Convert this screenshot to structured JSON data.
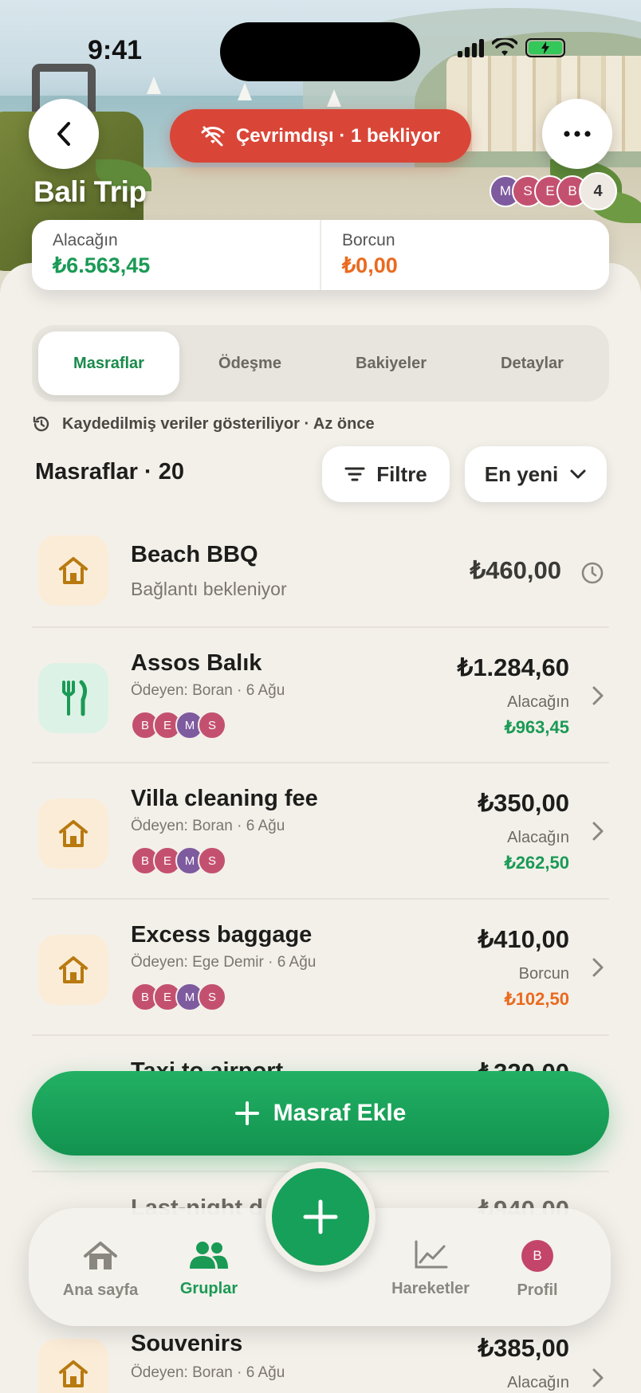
{
  "status_bar": {
    "time": "9:41"
  },
  "offline_banner": {
    "label": "Çevrimdışı · 1 bekliyor"
  },
  "group": {
    "title": "Bali Trip",
    "members": [
      "M",
      "S",
      "E",
      "B"
    ],
    "member_count": "4"
  },
  "balances": {
    "owed_label": "Alacağın",
    "owed_value": "₺6.563,45",
    "owe_label": "Borcun",
    "owe_value": "₺0,00"
  },
  "tabs": [
    {
      "label": "Masraflar",
      "active": true
    },
    {
      "label": "Ödeşme",
      "active": false
    },
    {
      "label": "Bakiyeler",
      "active": false
    },
    {
      "label": "Detaylar",
      "active": false
    }
  ],
  "cached_notice": "Kaydedilmiş veriler gösteriliyor · Az önce",
  "list": {
    "heading": "Masraflar · 20",
    "filter_label": "Filtre",
    "sort_label": "En yeni",
    "expenses": [
      {
        "title": "Beach BBQ",
        "subtitle": "Bağlantı bekleniyor",
        "amount": "₺460,00",
        "icon": "home-icon",
        "pending": true
      },
      {
        "title": "Assos Balık",
        "subtitle": "Ödeyen: Boran · 6 Ağu",
        "amount": "₺1.284,60",
        "share_label": "Alacağın",
        "share_value": "₺963,45",
        "icon": "fork-knife-icon",
        "participants": [
          "B",
          "E",
          "M",
          "S"
        ]
      },
      {
        "title": "Villa cleaning fee",
        "subtitle": "Ödeyen: Boran · 6 Ağu",
        "amount": "₺350,00",
        "share_label": "Alacağın",
        "share_value": "₺262,50",
        "icon": "home-icon",
        "participants": [
          "B",
          "E",
          "M",
          "S"
        ]
      },
      {
        "title": "Excess baggage",
        "subtitle": "Ödeyen: Ege Demir · 6 Ağu",
        "amount": "₺410,00",
        "share_label": "Borcun",
        "share_value": "₺102,50",
        "icon": "home-icon",
        "participants": [
          "B",
          "E",
          "M",
          "S"
        ]
      },
      {
        "title": "Taxi to airport",
        "amount": "₺320,00"
      },
      {
        "title": "Last-night d",
        "amount": "₺940,00"
      },
      {
        "title": "Souvenirs",
        "subtitle": "Ödeyen: Boran · 6 Ağu",
        "amount": "₺385,00",
        "share_label": "Alacağın",
        "icon": "home-icon"
      }
    ]
  },
  "add_expense_label": "Masraf Ekle",
  "tabbar": {
    "home": "Ana sayfa",
    "groups": "Gruplar",
    "activity": "Hareketler",
    "profile": "Profil",
    "profile_initial": "B"
  },
  "colors": {
    "green": "#1a9a55",
    "orange": "#ea6a1e",
    "offline_red": "#d94638",
    "avatar_purple": "#7e5a9f",
    "avatar_pink": "#c4506f"
  }
}
